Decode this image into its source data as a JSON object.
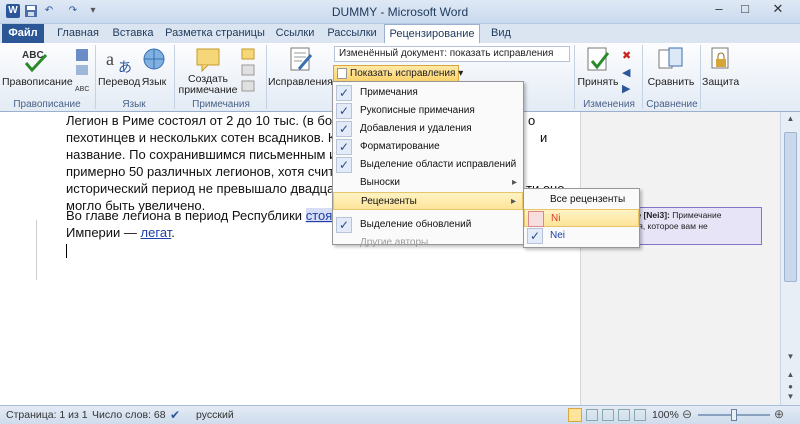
{
  "window": {
    "title": "DUMMY  -  Microsoft Word"
  },
  "qat": {
    "word_icon": "W",
    "save_icon": "save-icon",
    "undo_icon": "↶",
    "redo_icon": "↷"
  },
  "window_controls": {
    "minimize": "–",
    "maximize": "□",
    "close": "✕"
  },
  "tabs": [
    {
      "label": "Файл"
    },
    {
      "label": "Главная"
    },
    {
      "label": "Вставка"
    },
    {
      "label": "Разметка страницы"
    },
    {
      "label": "Ссылки"
    },
    {
      "label": "Рассылки"
    },
    {
      "label": "Рецензирование"
    },
    {
      "label": "Вид"
    }
  ],
  "ribbon": {
    "spelling": {
      "label": "Правописание",
      "group": "Правописание"
    },
    "language": {
      "translate": "Перевод",
      "lang": "Язык",
      "group": "Язык"
    },
    "comments": {
      "create": "Создать",
      "create2": "примечание",
      "group": "Примечания"
    },
    "tracking": {
      "fixes": "Исправления",
      "display_mode": "Изменённый документ: показать исправления",
      "show_markup": "Показать исправления"
    },
    "changes": {
      "accept": "Принять",
      "group": "Изменения"
    },
    "compare": {
      "label": "Сравнить",
      "group": "Сравнение"
    },
    "protect": {
      "label": "Защита"
    }
  },
  "document": {
    "lines": [
      "Легион в Риме состоял от 2 до 10 тыс. (в бол",
      "пехотинцев и нескольких сотен всадников. К",
      "название. По сохранившимся письменным и",
      "примерно 50 различных легионов, хотя счит",
      "исторический период не превышало двадца",
      "могло быть увеличено."
    ],
    "right_fragments": [
      "о",
      "и",
      "ти оно"
    ],
    "para2_line1": "Во главе легиона в период Республики",
    "para2_highlight": "стоя",
    "para2_line2": "Империи —",
    "para2_link": "легат",
    "para2_end": "."
  },
  "comment": {
    "author": "Примечание [Nei3]:",
    "text": "Примечание пользователя, которое вам не"
  },
  "show_markup_menu": [
    {
      "label": "Примечания",
      "checked": true
    },
    {
      "label": "Рукописные примечания",
      "checked": true
    },
    {
      "label": "Добавления и удаления",
      "checked": true
    },
    {
      "label": "Форматирование",
      "checked": true
    },
    {
      "label": "Выделение области исправлений",
      "checked": true
    },
    {
      "label": "Выноски",
      "checked": false,
      "submenu": true
    },
    {
      "label": "Рецензенты",
      "checked": false,
      "submenu": true,
      "highlight": true
    },
    {
      "label": "Выделение обновлений",
      "checked": true
    },
    {
      "label": "Другие авторы",
      "checked": false,
      "disabled": true
    }
  ],
  "reviewers_menu": [
    {
      "label": "Все рецензенты",
      "checked": false
    },
    {
      "label": "Ni",
      "checked": false,
      "color": "#d93b2b",
      "highlight": true
    },
    {
      "label": "Nei",
      "checked": true,
      "color": "#1c3fa8"
    }
  ],
  "status": {
    "page": "Страница: 1 из 1",
    "words": "Число слов: 68",
    "lang": "русский",
    "zoom": "100%",
    "zoom_level": 1.0
  }
}
